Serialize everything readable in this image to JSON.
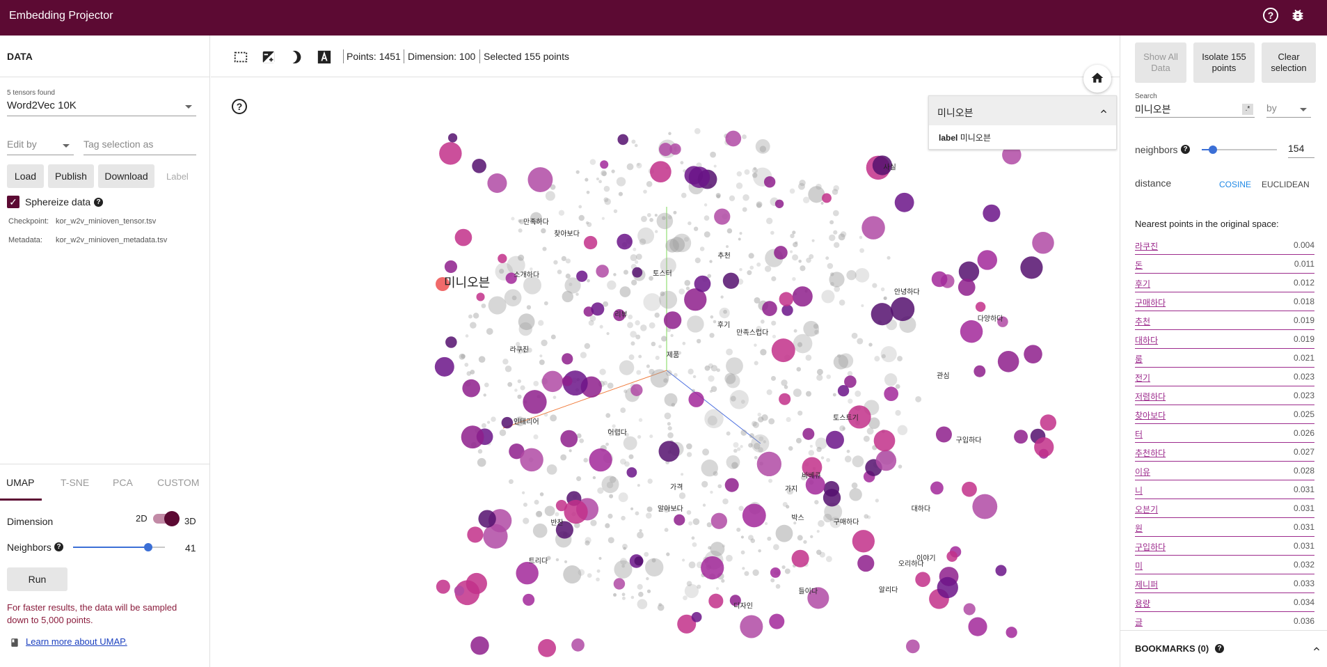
{
  "app": {
    "title": "Embedding Projector"
  },
  "data_panel": {
    "header": "DATA",
    "tensors_found": "5 tensors found",
    "tensor_select": "Word2Vec 10K",
    "edit_by": "Edit by",
    "tag_placeholder": "Tag selection as",
    "load": "Load",
    "publish": "Publish",
    "download": "Download",
    "label": "Label",
    "sphereize": "Sphereize data",
    "checkpoint_label": "Checkpoint:",
    "checkpoint_value": "kor_w2v_minioven_tensor.tsv",
    "metadata_label": "Metadata:",
    "metadata_value": "kor_w2v_minioven_metadata.tsv"
  },
  "projection_tabs": [
    "UMAP",
    "T-SNE",
    "PCA",
    "CUSTOM"
  ],
  "umap": {
    "dimension_label": "Dimension",
    "dim_2d": "2D",
    "dim_3d": "3D",
    "neighbors_label": "Neighbors",
    "neighbors_value": "41",
    "neighbors_slider_fraction": 0.82,
    "run": "Run",
    "warning": "For faster results, the data will be sampled down to 5,000 points.",
    "learn_more": "Learn more about UMAP."
  },
  "toolbar": {
    "points": "Points: 1451",
    "dimension": "Dimension: 100",
    "selected": "Selected 155 points"
  },
  "info_card": {
    "title": "미니오븐",
    "label_key": "label",
    "label_value": "미니오븐"
  },
  "inspector": {
    "show_all": "Show All Data",
    "isolate": "Isolate 155 points",
    "clear": "Clear selection",
    "search_label": "Search",
    "search_value": "미니오븐",
    "by": "by",
    "neighbors_label": "neighbors",
    "neighbors_value": "154",
    "distance_label": "distance",
    "cosine": "COSINE",
    "euclidean": "EUCLIDEAN",
    "nearest_title": "Nearest points in the original space:",
    "nearest": [
      [
        "라쿠진",
        "0.004"
      ],
      [
        "돈",
        "0.011"
      ],
      [
        "후기",
        "0.012"
      ],
      [
        "구매하다",
        "0.018"
      ],
      [
        "추천",
        "0.019"
      ],
      [
        "대하다",
        "0.019"
      ],
      [
        "룸",
        "0.021"
      ],
      [
        "전기",
        "0.023"
      ],
      [
        "저렴하다",
        "0.023"
      ],
      [
        "찾아보다",
        "0.025"
      ],
      [
        "터",
        "0.026"
      ],
      [
        "추천하다",
        "0.027"
      ],
      [
        "이유",
        "0.028"
      ],
      [
        "니",
        "0.031"
      ],
      [
        "오븐기",
        "0.031"
      ],
      [
        "원",
        "0.031"
      ],
      [
        "구입하다",
        "0.031"
      ],
      [
        "미",
        "0.032"
      ],
      [
        "제니퍼",
        "0.033"
      ],
      [
        "용량",
        "0.034"
      ],
      [
        "글",
        "0.036"
      ]
    ],
    "bookmarks": "BOOKMARKS (0)"
  },
  "scatter": {
    "focus_label": "미니오븐",
    "labels": [
      [
        "인테리어"
      ],
      [
        "토스터"
      ],
      [
        "디자인"
      ],
      [
        "어렵다"
      ],
      [
        "다양하다"
      ],
      [
        "가격"
      ],
      [
        "만족하다"
      ],
      [
        "구매하다"
      ],
      [
        "추천"
      ],
      [
        "구입하다"
      ],
      [
        "이야기"
      ],
      [
        "트리다"
      ],
      [
        "소개하다"
      ],
      [
        "알리다"
      ],
      [
        "들이다"
      ],
      [
        "관심"
      ],
      [
        "안녕하다"
      ],
      [
        "알아보다"
      ],
      [
        "토스트기"
      ],
      [
        "리뷰"
      ],
      [
        "바베큐"
      ],
      [
        "오리하다"
      ],
      [
        "만족스럽다"
      ],
      [
        "사실"
      ],
      [
        "가지"
      ],
      [
        "대하다"
      ],
      [
        "찾아보다"
      ],
      [
        "제품"
      ],
      [
        "박스"
      ],
      [
        "라쿠진"
      ],
      [
        "후기"
      ],
      [
        "반찬"
      ]
    ]
  }
}
